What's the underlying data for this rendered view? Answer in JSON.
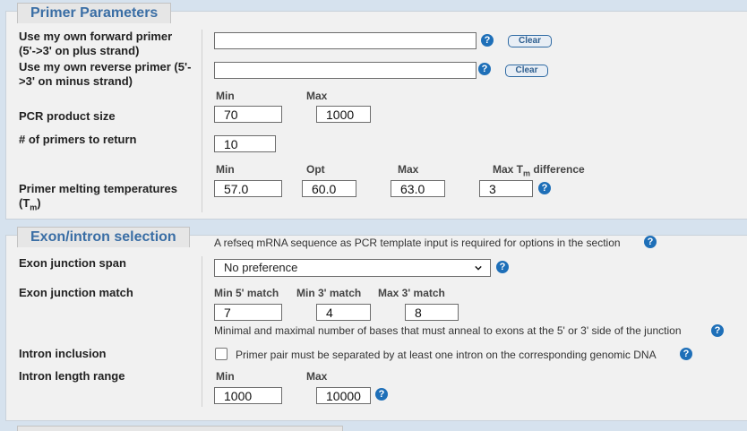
{
  "primer_params": {
    "legend": "Primer Parameters",
    "forward_label": "Use my own forward primer (5'->3' on plus strand)",
    "forward_value": "",
    "reverse_label": "Use my own reverse primer (5'->3' on minus strand)",
    "reverse_value": "",
    "clear_label": "Clear",
    "min_label": "Min",
    "max_label": "Max",
    "opt_label": "Opt",
    "pcr_label": "PCR product size",
    "pcr_min": "70",
    "pcr_max": "1000",
    "num_primers_label": "# of primers to return",
    "num_primers": "10",
    "tm_label_text": "Primer melting temperatures (T",
    "tm_label_sub": "m",
    "tm_label_close": ")",
    "tm_min": "57.0",
    "tm_opt": "60.0",
    "tm_max": "63.0",
    "tm_diff_label_a": "Max T",
    "tm_diff_label_sub": "m",
    "tm_diff_label_b": " difference",
    "tm_diff": "3"
  },
  "exon_intron": {
    "legend": "Exon/intron selection",
    "note": "A refseq mRNA sequence as PCR template input is required for options in the section",
    "junction_span_label": "Exon junction span",
    "junction_span_value": "No preference",
    "junction_match_label": "Exon junction match",
    "min5_label": "Min 5' match",
    "min3_label": "Min 3' match",
    "max3_label": "Max 3' match",
    "min5": "7",
    "min3": "4",
    "max3": "8",
    "match_note": "Minimal and maximal number of bases that must anneal to exons at the 5' or 3' side of the junction",
    "intron_inclusion_label": "Intron inclusion",
    "intron_inclusion_text": "Primer pair must be separated by at least one intron on the corresponding genomic DNA",
    "intron_inclusion_checked": false,
    "intron_length_label": "Intron length range",
    "min_label": "Min",
    "max_label": "Max",
    "intron_min": "1000",
    "intron_max": "10000"
  },
  "help_glyph": "?",
  "colors": {
    "accent": "#3a6ea5",
    "help": "#1e6fb8",
    "background": "#d6e2ee",
    "panel": "#f1f1f1"
  }
}
